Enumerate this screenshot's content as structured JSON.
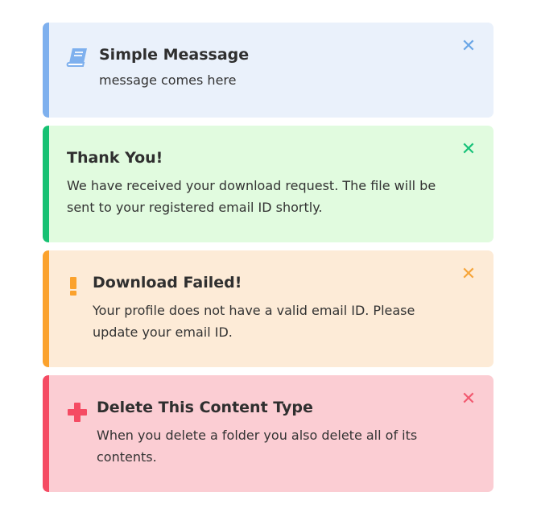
{
  "alerts": [
    {
      "type": "info",
      "icon": "book-icon",
      "title": "Simple Meassage",
      "message": "message comes here",
      "close_icon": "close-icon",
      "color": "#7eb0ee"
    },
    {
      "type": "success",
      "icon": "",
      "title": "Thank You!",
      "message": "We have received your download request. The file will be sent to your registered email ID shortly.",
      "close_icon": "close-icon",
      "color": "#16c173"
    },
    {
      "type": "warning",
      "icon": "exclamation-icon",
      "title": "Download Failed!",
      "message": "Your profile does not have a valid email ID. Please update your email ID.",
      "close_icon": "close-icon",
      "color": "#fba22d"
    },
    {
      "type": "error",
      "icon": "plus-icon",
      "title": "Delete This Content Type",
      "message": "When you delete a folder you also delete all of its contents.",
      "close_icon": "close-icon",
      "color": "#f54b63"
    }
  ],
  "glyphs": {
    "close": "✕"
  }
}
